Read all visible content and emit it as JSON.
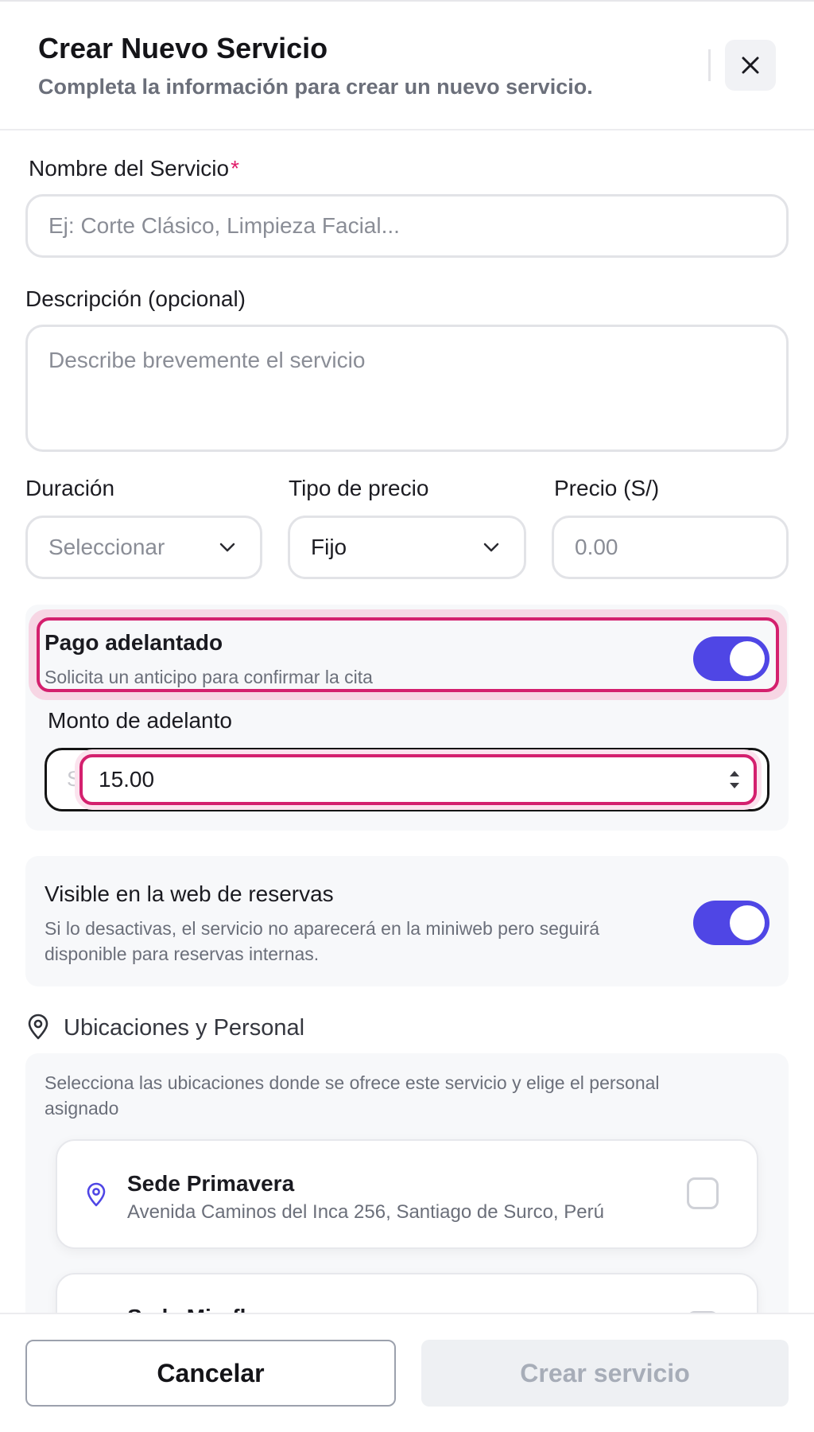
{
  "header": {
    "title": "Crear Nuevo Servicio",
    "subtitle": "Completa la información para crear un nuevo servicio."
  },
  "form": {
    "name_label": "Nombre del Servicio",
    "required_mark": "*",
    "name_placeholder": "Ej: Corte Clásico, Limpieza Facial...",
    "description_label": "Descripción (opcional)",
    "description_placeholder": "Describe brevemente el servicio",
    "duration_label": "Duración",
    "duration_value": "Seleccionar",
    "price_type_label": "Tipo de precio",
    "price_type_value": "Fijo",
    "price_label": "Precio (S/)",
    "price_placeholder": "0.00"
  },
  "advance_payment": {
    "title": "Pago adelantado",
    "subtitle": "Solicita un anticipo para confirmar la cita",
    "enabled": true,
    "amount_label": "Monto de adelanto",
    "currency_prefix": "S/",
    "amount_value": "15.00"
  },
  "visibility": {
    "title": "Visible en la web de reservas",
    "description_line1": "Si lo desactivas, el servicio no aparecerá en la miniweb pero seguirá",
    "description_line2": "disponible para reservas internas.",
    "enabled": true
  },
  "locations": {
    "title": "Ubicaciones y Personal",
    "intro_line1": "Selecciona las ubicaciones donde se ofrece este servicio y elige el personal",
    "intro_line2": "asignado",
    "items": [
      {
        "name": "Sede Primavera",
        "address": "Avenida Caminos del Inca 256, Santiago de Surco, Perú",
        "checked": false
      },
      {
        "name": "Sede Miraflores",
        "address": "",
        "checked": false
      }
    ]
  },
  "footer": {
    "cancel_label": "Cancelar",
    "create_label": "Crear servicio"
  },
  "colors": {
    "accent": "#4f46e5",
    "highlight": "#d4206e",
    "required": "#e11d6a"
  }
}
